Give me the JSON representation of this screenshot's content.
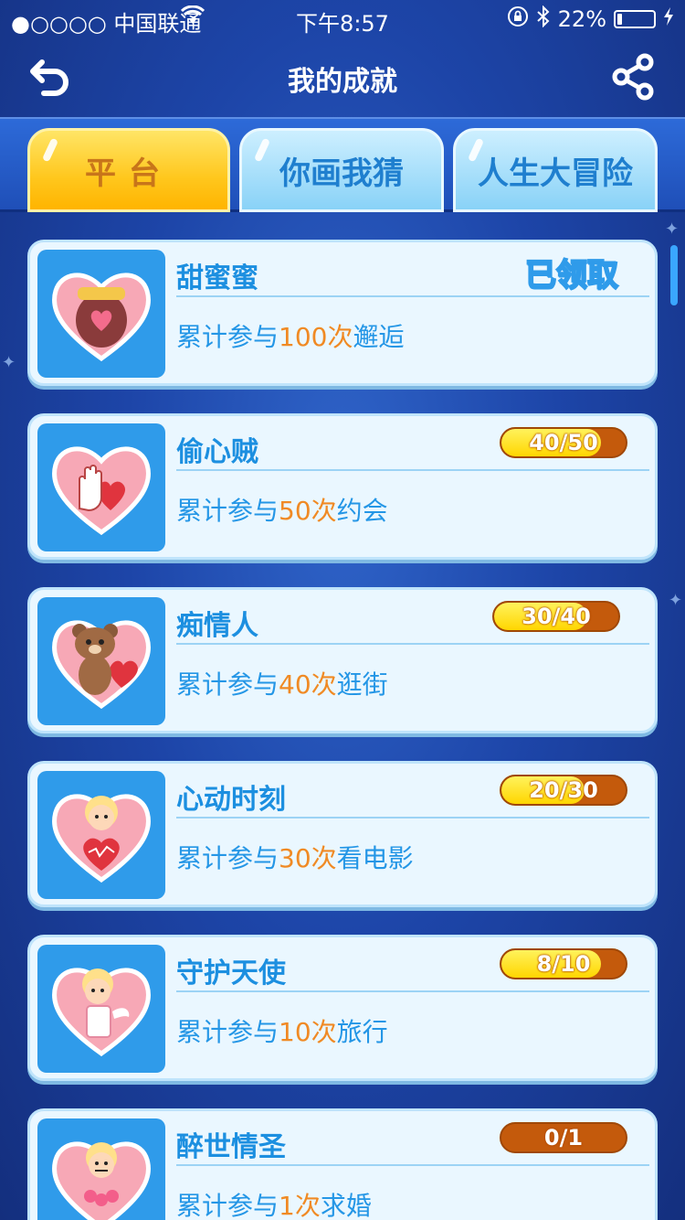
{
  "status_bar": {
    "carrier": "●○○○○ 中国联通",
    "time": "下午8:57",
    "battery_percent": "22%",
    "battery_level": 0.22
  },
  "nav": {
    "title": "我的成就",
    "back_icon": "back-arrow-icon",
    "share_icon": "share-icon"
  },
  "tabs": [
    {
      "label": "平台",
      "active": true
    },
    {
      "label": "你画我猜",
      "active": false
    },
    {
      "label": "人生大冒险",
      "active": false
    }
  ],
  "achievements": [
    {
      "name": "甜蜜蜜",
      "desc_prefix": "累计参与",
      "count": "100次",
      "desc_suffix": "邂逅",
      "status": "已领取",
      "icon": "honey-jar-heart-icon"
    },
    {
      "name": "偷心贼",
      "desc_prefix": "累计参与",
      "count": "50次",
      "desc_suffix": "约会",
      "progress": "40/50",
      "progress_value": 0.8,
      "icon": "hand-heart-icon"
    },
    {
      "name": "痴情人",
      "desc_prefix": "累计参与",
      "count": "40次",
      "desc_suffix": "逛街",
      "progress": "30/40",
      "progress_value": 0.75,
      "icon": "bear-heart-icon"
    },
    {
      "name": "心动时刻",
      "desc_prefix": "累计参与",
      "count": "30次",
      "desc_suffix": "看电影",
      "progress": "20/30",
      "progress_value": 0.667,
      "icon": "cupid-heart-icon"
    },
    {
      "name": "守护天使",
      "desc_prefix": "累计参与",
      "count": "10次",
      "desc_suffix": "旅行",
      "progress": "8/10",
      "progress_value": 0.8,
      "icon": "angel-heart-icon"
    },
    {
      "name": "醉世情圣",
      "desc_prefix": "累计参与",
      "count": "1次",
      "desc_suffix": "求婚",
      "progress": "0/1",
      "progress_value": 0,
      "icon": "cupid-roses-heart-icon"
    }
  ],
  "colors": {
    "background": "#1d45a8",
    "tab_active": "#ffc71d",
    "tab_inactive": "#89d2f7",
    "card": "#eaf7ff",
    "title_blue": "#1c8fe0",
    "accent_orange": "#f08a24",
    "progress_track": "#c45a0c",
    "progress_fill": "#ffd600"
  }
}
